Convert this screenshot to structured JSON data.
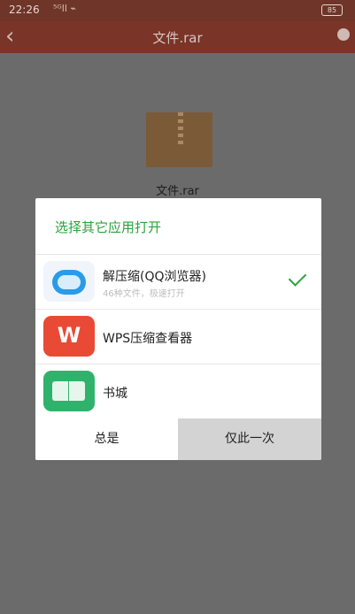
{
  "status_bar": {
    "time": "22:26",
    "signal_text": "⁵ᴳll ⌁",
    "battery": "85"
  },
  "app_bar": {
    "title": "文件.rar",
    "back_icon": "back-arrow-icon",
    "more_icon": "overflow-icon"
  },
  "file": {
    "name": "文件.rar"
  },
  "dialog": {
    "title": "选择其它应用打开",
    "apps": [
      {
        "name": "解压缩(QQ浏览器)",
        "subtitle": "46种文件，极速打开",
        "selected": true
      },
      {
        "name": "WPS压缩查看器",
        "subtitle": "",
        "selected": false
      },
      {
        "name": "书城",
        "subtitle": "",
        "selected": false
      }
    ],
    "buttons": {
      "always": "总是",
      "once": "仅此一次"
    }
  },
  "colors": {
    "accent": "#2aa33a",
    "app_bar": "#7a3428"
  }
}
